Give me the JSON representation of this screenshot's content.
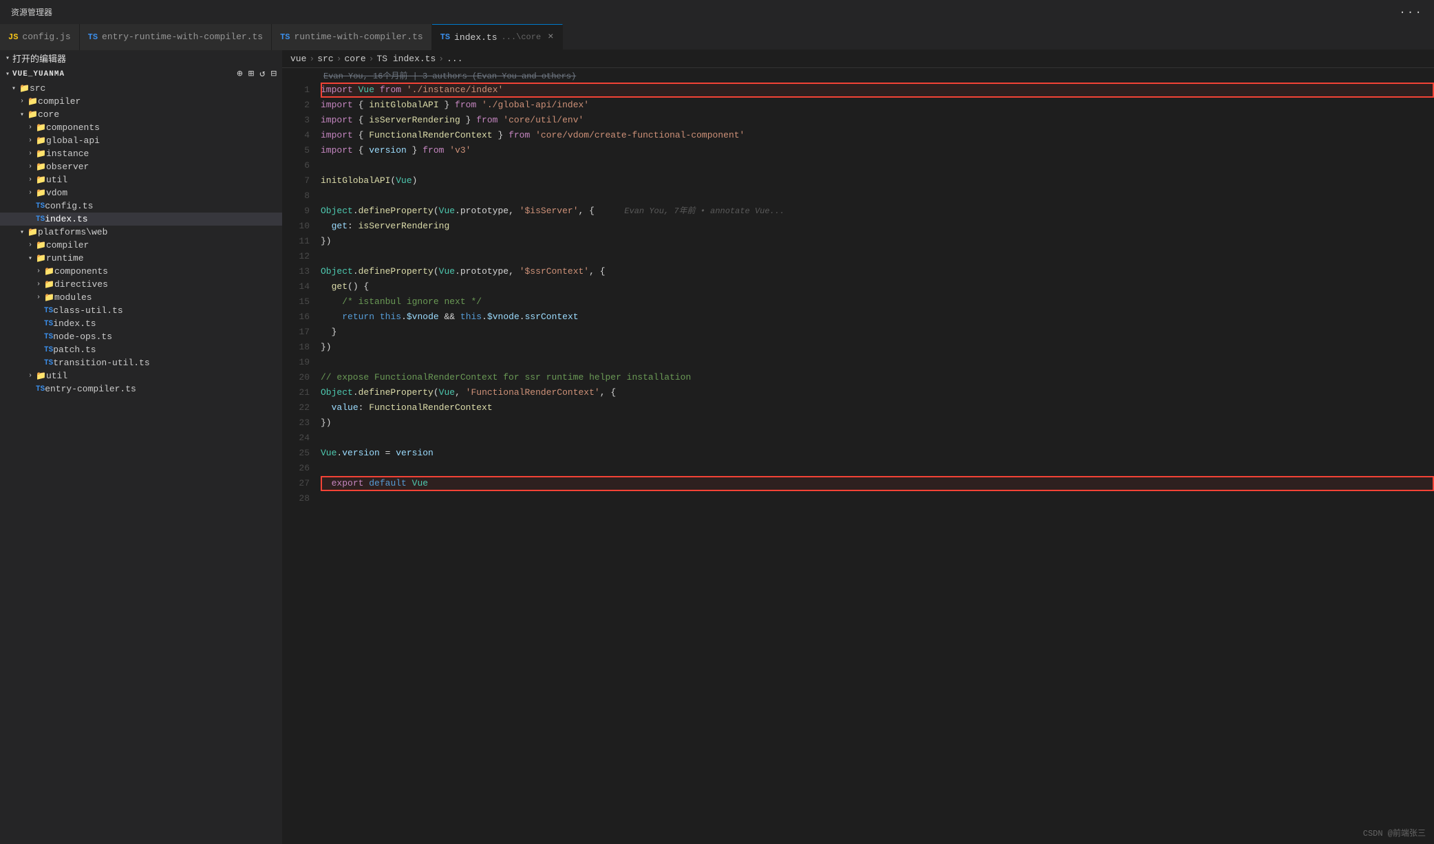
{
  "titleBar": {
    "explorerLabel": "资源管理器",
    "moreIcon": "···"
  },
  "tabs": [
    {
      "id": "config-js",
      "badge": "JS",
      "label": "config.js",
      "active": false
    },
    {
      "id": "entry-runtime",
      "badge": "TS",
      "label": "entry-runtime-with-compiler.ts",
      "active": false
    },
    {
      "id": "runtime-with-compiler",
      "badge": "TS",
      "label": "runtime-with-compiler.ts",
      "active": false
    },
    {
      "id": "index-ts",
      "badge": "TS",
      "label": "index.ts",
      "path": "...\\core",
      "active": true,
      "closable": true
    }
  ],
  "sidebar": {
    "openEditorsLabel": "打开的编辑器",
    "rootLabel": "VUE_YUANMA",
    "tree": [
      {
        "type": "folder",
        "label": "src",
        "depth": 1,
        "expanded": true
      },
      {
        "type": "folder",
        "label": "compiler",
        "depth": 2,
        "expanded": false
      },
      {
        "type": "folder",
        "label": "core",
        "depth": 2,
        "expanded": true
      },
      {
        "type": "folder",
        "label": "components",
        "depth": 3,
        "expanded": false
      },
      {
        "type": "folder",
        "label": "global-api",
        "depth": 3,
        "expanded": false
      },
      {
        "type": "folder",
        "label": "instance",
        "depth": 3,
        "expanded": false
      },
      {
        "type": "folder",
        "label": "observer",
        "depth": 3,
        "expanded": false
      },
      {
        "type": "folder",
        "label": "util",
        "depth": 3,
        "expanded": false
      },
      {
        "type": "folder",
        "label": "vdom",
        "depth": 3,
        "expanded": false
      },
      {
        "type": "file",
        "badge": "TS",
        "label": "config.ts",
        "depth": 3
      },
      {
        "type": "file",
        "badge": "TS",
        "label": "index.ts",
        "depth": 3,
        "active": true
      },
      {
        "type": "folder",
        "label": "platforms\\web",
        "depth": 2,
        "expanded": true
      },
      {
        "type": "folder",
        "label": "compiler",
        "depth": 3,
        "expanded": false
      },
      {
        "type": "folder",
        "label": "runtime",
        "depth": 3,
        "expanded": true
      },
      {
        "type": "folder",
        "label": "components",
        "depth": 4,
        "expanded": false
      },
      {
        "type": "folder",
        "label": "directives",
        "depth": 4,
        "expanded": false
      },
      {
        "type": "folder",
        "label": "modules",
        "depth": 4,
        "expanded": false
      },
      {
        "type": "file",
        "badge": "TS",
        "label": "class-util.ts",
        "depth": 4
      },
      {
        "type": "file",
        "badge": "TS",
        "label": "index.ts",
        "depth": 4
      },
      {
        "type": "file",
        "badge": "TS",
        "label": "node-ops.ts",
        "depth": 4
      },
      {
        "type": "file",
        "badge": "TS",
        "label": "patch.ts",
        "depth": 4
      },
      {
        "type": "file",
        "badge": "TS",
        "label": "transition-util.ts",
        "depth": 4
      },
      {
        "type": "folder",
        "label": "util",
        "depth": 3,
        "expanded": false
      },
      {
        "type": "file",
        "badge": "TS",
        "label": "entry-compiler.ts",
        "depth": 3
      }
    ]
  },
  "breadcrumb": {
    "items": [
      "vue",
      "src",
      "core",
      "TS index.ts",
      "..."
    ]
  },
  "gitBlame": "Evan You, 16个月前 | 3 authors (Evan You and others)",
  "code": {
    "lines": [
      {
        "num": 1,
        "highlighted": true,
        "tokens": [
          {
            "t": "kw2",
            "v": "import"
          },
          {
            "t": "plain",
            "v": " "
          },
          {
            "t": "cls",
            "v": "Vue"
          },
          {
            "t": "plain",
            "v": " "
          },
          {
            "t": "kw2",
            "v": "from"
          },
          {
            "t": "plain",
            "v": " "
          },
          {
            "t": "str",
            "v": "'./instance/index'"
          }
        ]
      },
      {
        "num": 2,
        "tokens": [
          {
            "t": "kw2",
            "v": "import"
          },
          {
            "t": "plain",
            "v": " { "
          },
          {
            "t": "fn",
            "v": "initGlobalAPI"
          },
          {
            "t": "plain",
            "v": " } "
          },
          {
            "t": "kw2",
            "v": "from"
          },
          {
            "t": "plain",
            "v": " "
          },
          {
            "t": "str",
            "v": "'./global-api/index'"
          }
        ]
      },
      {
        "num": 3,
        "tokens": [
          {
            "t": "kw2",
            "v": "import"
          },
          {
            "t": "plain",
            "v": " { "
          },
          {
            "t": "fn",
            "v": "isServerRendering"
          },
          {
            "t": "plain",
            "v": " } "
          },
          {
            "t": "kw2",
            "v": "from"
          },
          {
            "t": "plain",
            "v": " "
          },
          {
            "t": "str",
            "v": "'core/util/env'"
          }
        ]
      },
      {
        "num": 4,
        "tokens": [
          {
            "t": "kw2",
            "v": "import"
          },
          {
            "t": "plain",
            "v": " { "
          },
          {
            "t": "fn",
            "v": "FunctionalRenderContext"
          },
          {
            "t": "plain",
            "v": " } "
          },
          {
            "t": "kw2",
            "v": "from"
          },
          {
            "t": "plain",
            "v": " "
          },
          {
            "t": "str",
            "v": "'core/vdom/create-functional-component'"
          }
        ]
      },
      {
        "num": 5,
        "tokens": [
          {
            "t": "kw2",
            "v": "import"
          },
          {
            "t": "plain",
            "v": " { "
          },
          {
            "t": "prop",
            "v": "version"
          },
          {
            "t": "plain",
            "v": " } "
          },
          {
            "t": "kw2",
            "v": "from"
          },
          {
            "t": "plain",
            "v": " "
          },
          {
            "t": "str",
            "v": "'v3'"
          }
        ]
      },
      {
        "num": 6,
        "tokens": []
      },
      {
        "num": 7,
        "tokens": [
          {
            "t": "fn",
            "v": "initGlobalAPI"
          },
          {
            "t": "plain",
            "v": "("
          },
          {
            "t": "cls",
            "v": "Vue"
          },
          {
            "t": "plain",
            "v": ")"
          }
        ]
      },
      {
        "num": 8,
        "tokens": []
      },
      {
        "num": 9,
        "tokens": [
          {
            "t": "cls",
            "v": "Object"
          },
          {
            "t": "plain",
            "v": "."
          },
          {
            "t": "fn",
            "v": "defineProperty"
          },
          {
            "t": "plain",
            "v": "("
          },
          {
            "t": "cls",
            "v": "Vue"
          },
          {
            "t": "plain",
            "v": ".prototype, "
          },
          {
            "t": "str",
            "v": "'$isServer'"
          },
          {
            "t": "plain",
            "v": ", {"
          },
          {
            "t": "plain",
            "v": "   "
          },
          {
            "t": "inline-blame",
            "v": "Evan You, 7年前 • annotate Vue..."
          }
        ],
        "hasBlame": true
      },
      {
        "num": 10,
        "tokens": [
          {
            "t": "plain",
            "v": "  "
          },
          {
            "t": "prop",
            "v": "get"
          },
          {
            "t": "plain",
            "v": ": "
          },
          {
            "t": "fn",
            "v": "isServerRendering"
          }
        ]
      },
      {
        "num": 11,
        "tokens": [
          {
            "t": "plain",
            "v": "})"
          }
        ]
      },
      {
        "num": 12,
        "tokens": []
      },
      {
        "num": 13,
        "tokens": [
          {
            "t": "cls",
            "v": "Object"
          },
          {
            "t": "plain",
            "v": "."
          },
          {
            "t": "fn",
            "v": "defineProperty"
          },
          {
            "t": "plain",
            "v": "("
          },
          {
            "t": "cls",
            "v": "Vue"
          },
          {
            "t": "plain",
            "v": ".prototype, "
          },
          {
            "t": "str",
            "v": "'$ssrContext'"
          },
          {
            "t": "plain",
            "v": ", {"
          }
        ]
      },
      {
        "num": 14,
        "tokens": [
          {
            "t": "plain",
            "v": "  "
          },
          {
            "t": "fn",
            "v": "get"
          },
          {
            "t": "plain",
            "v": "() {"
          }
        ]
      },
      {
        "num": 15,
        "tokens": [
          {
            "t": "plain",
            "v": "    "
          },
          {
            "t": "comment",
            "v": "/* istanbul ignore next */"
          }
        ]
      },
      {
        "num": 16,
        "tokens": [
          {
            "t": "plain",
            "v": "    "
          },
          {
            "t": "kw",
            "v": "return"
          },
          {
            "t": "plain",
            "v": " "
          },
          {
            "t": "kw",
            "v": "this"
          },
          {
            "t": "plain",
            "v": "."
          },
          {
            "t": "prop",
            "v": "$vnode"
          },
          {
            "t": "plain",
            "v": " && "
          },
          {
            "t": "kw",
            "v": "this"
          },
          {
            "t": "plain",
            "v": "."
          },
          {
            "t": "prop",
            "v": "$vnode"
          },
          {
            "t": "plain",
            "v": "."
          },
          {
            "t": "prop",
            "v": "ssrContext"
          }
        ]
      },
      {
        "num": 17,
        "tokens": [
          {
            "t": "plain",
            "v": "  }"
          }
        ]
      },
      {
        "num": 18,
        "tokens": [
          {
            "t": "plain",
            "v": "})"
          }
        ]
      },
      {
        "num": 19,
        "tokens": []
      },
      {
        "num": 20,
        "tokens": [
          {
            "t": "comment",
            "v": "// expose FunctionalRenderContext for ssr runtime helper installation"
          }
        ]
      },
      {
        "num": 21,
        "tokens": [
          {
            "t": "cls",
            "v": "Object"
          },
          {
            "t": "plain",
            "v": "."
          },
          {
            "t": "fn",
            "v": "defineProperty"
          },
          {
            "t": "plain",
            "v": "("
          },
          {
            "t": "cls",
            "v": "Vue"
          },
          {
            "t": "plain",
            "v": ", "
          },
          {
            "t": "str",
            "v": "'FunctionalRenderContext'"
          },
          {
            "t": "plain",
            "v": ", {"
          }
        ]
      },
      {
        "num": 22,
        "tokens": [
          {
            "t": "plain",
            "v": "  "
          },
          {
            "t": "prop",
            "v": "value"
          },
          {
            "t": "plain",
            "v": ": "
          },
          {
            "t": "fn",
            "v": "FunctionalRenderContext"
          }
        ]
      },
      {
        "num": 23,
        "tokens": [
          {
            "t": "plain",
            "v": "})"
          }
        ]
      },
      {
        "num": 24,
        "tokens": []
      },
      {
        "num": 25,
        "tokens": [
          {
            "t": "cls",
            "v": "Vue"
          },
          {
            "t": "plain",
            "v": "."
          },
          {
            "t": "prop",
            "v": "version"
          },
          {
            "t": "plain",
            "v": " = "
          },
          {
            "t": "prop",
            "v": "version"
          }
        ]
      },
      {
        "num": 26,
        "tokens": []
      },
      {
        "num": 27,
        "highlighted": true,
        "tokens": [
          {
            "t": "plain",
            "v": "  "
          },
          {
            "t": "kw2",
            "v": "export"
          },
          {
            "t": "plain",
            "v": " "
          },
          {
            "t": "kw",
            "v": "default"
          },
          {
            "t": "plain",
            "v": " "
          },
          {
            "t": "cls",
            "v": "Vue"
          }
        ]
      },
      {
        "num": 28,
        "tokens": []
      }
    ]
  },
  "watermark": "CSDN @前端张三"
}
